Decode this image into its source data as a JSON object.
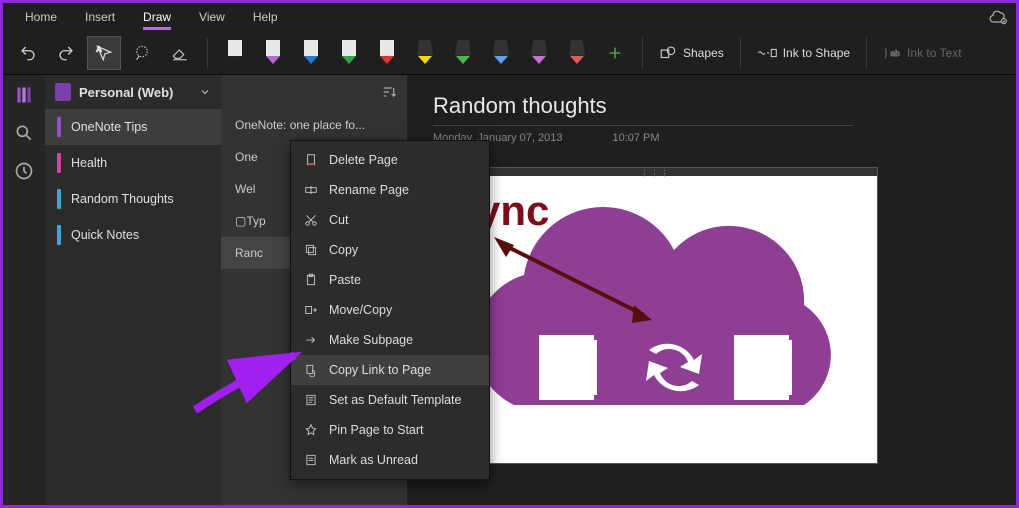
{
  "menubar": {
    "items": [
      "Home",
      "Insert",
      "Draw",
      "View",
      "Help"
    ],
    "active": 2
  },
  "ribbon": {
    "pens": [
      {
        "body": "#e8e8e8",
        "tip": "#222"
      },
      {
        "body": "#e8e8e8",
        "tip": "#b36cd2"
      },
      {
        "body": "#e8e8e8",
        "tip": "#2a78d4"
      },
      {
        "body": "#e8e8e8",
        "tip": "#2fa54a"
      },
      {
        "body": "#e8e8e8",
        "tip": "#d33"
      }
    ],
    "highlighters": [
      {
        "body": "#333",
        "tip": "#f5d90a"
      },
      {
        "body": "#333",
        "tip": "#4fb54f"
      },
      {
        "body": "#333",
        "tip": "#5aa0ee"
      },
      {
        "body": "#333",
        "tip": "#c86cd8"
      },
      {
        "body": "#333",
        "tip": "#e05a5a"
      }
    ],
    "shapes_label": "Shapes",
    "ink_to_shape_label": "Ink to Shape",
    "ink_to_text_label": "Ink to Text"
  },
  "notebook": {
    "name": "Personal (Web)"
  },
  "sections": [
    {
      "label": "OneNote Tips",
      "color": "#9a4fc9",
      "selected": true
    },
    {
      "label": "Health",
      "color": "#d63fa6"
    },
    {
      "label": "Random Thoughts",
      "color": "#3fa5d6"
    },
    {
      "label": "Quick Notes",
      "color": "#3fa5d6"
    }
  ],
  "pages": [
    {
      "label": "OneNote: one place fo..."
    },
    {
      "label": "One"
    },
    {
      "label": "Wel"
    },
    {
      "label": "▢Typ"
    },
    {
      "label": "Ranc",
      "selected": true
    }
  ],
  "page": {
    "title": "Random thoughts",
    "date": "Monday, January 07, 2013",
    "time": "10:07 PM",
    "canvas_text": "Sync"
  },
  "contextMenu": {
    "items": [
      {
        "icon": "delete",
        "label": "Delete Page"
      },
      {
        "icon": "rename",
        "label": "Rename Page"
      },
      {
        "icon": "cut",
        "label": "Cut"
      },
      {
        "icon": "copy",
        "label": "Copy"
      },
      {
        "icon": "paste",
        "label": "Paste"
      },
      {
        "icon": "move",
        "label": "Move/Copy"
      },
      {
        "icon": "subpage",
        "label": "Make Subpage"
      },
      {
        "icon": "link",
        "label": "Copy Link to Page",
        "hl": true
      },
      {
        "icon": "template",
        "label": "Set as Default Template"
      },
      {
        "icon": "pin",
        "label": "Pin Page to Start"
      },
      {
        "icon": "unread",
        "label": "Mark as Unread"
      }
    ]
  }
}
